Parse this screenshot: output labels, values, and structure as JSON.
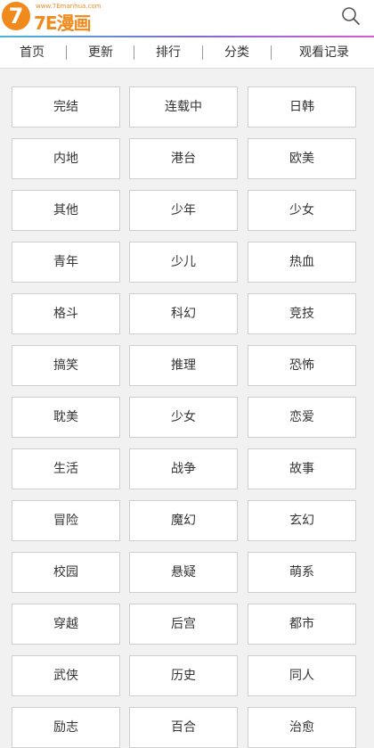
{
  "logo": {
    "badge": "7",
    "domain": "www.7Emanhua.com",
    "name": "7E漫画"
  },
  "nav": {
    "items": [
      "首页",
      "更新",
      "排行",
      "分类",
      "观看记录"
    ]
  },
  "categories": [
    "完结",
    "连载中",
    "日韩",
    "内地",
    "港台",
    "欧美",
    "其他",
    "少年",
    "少女",
    "青年",
    "少儿",
    "热血",
    "格斗",
    "科幻",
    "竞技",
    "搞笑",
    "推理",
    "恐怖",
    "耽美",
    "少女",
    "恋爱",
    "生活",
    "战争",
    "故事",
    "冒险",
    "魔幻",
    "玄幻",
    "校园",
    "悬疑",
    "萌系",
    "穿越",
    "后宫",
    "都市",
    "武侠",
    "历史",
    "同人",
    "励志",
    "百合",
    "治愈"
  ],
  "colors": {
    "brand": "#f08a1c",
    "accent_gradient_start": "#45b7d8",
    "accent_gradient_end": "#d65ad3"
  }
}
